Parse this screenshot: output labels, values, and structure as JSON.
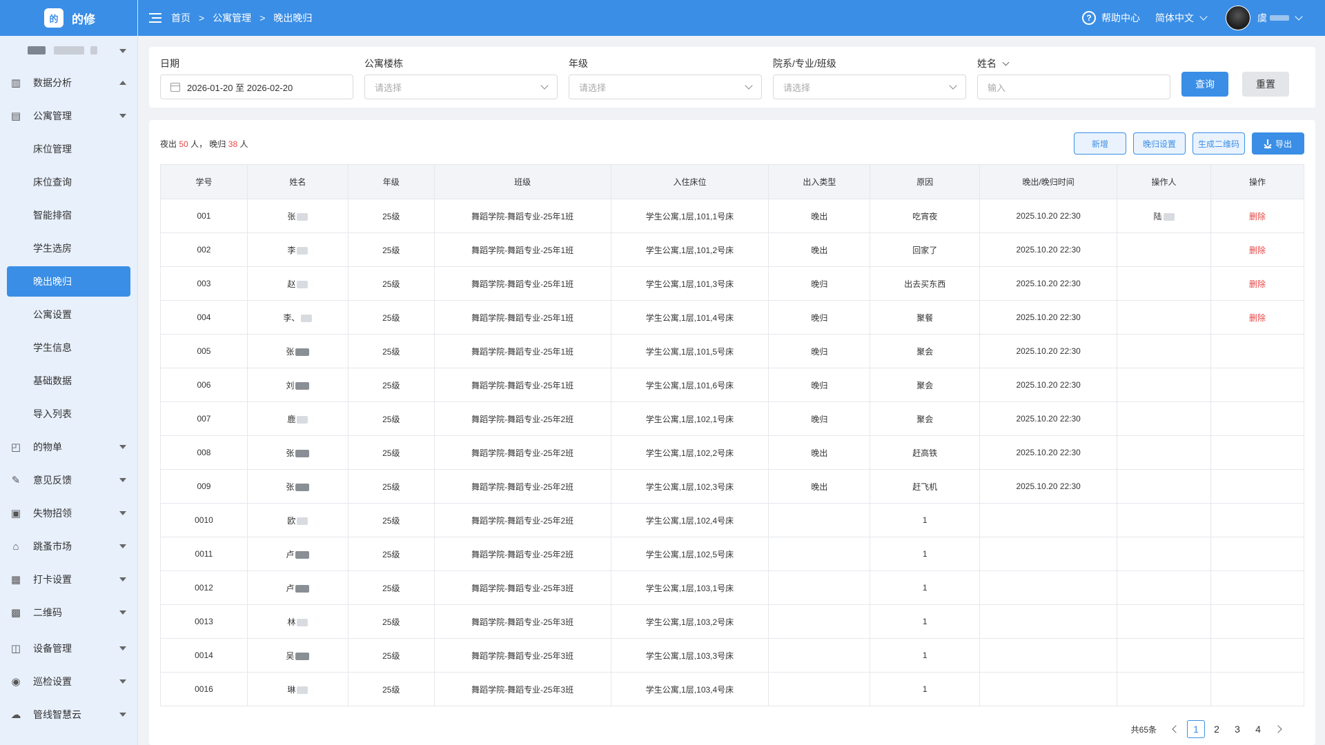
{
  "app": {
    "name": "的修",
    "logo_mark": "的"
  },
  "colors": {
    "primary": "#3a8ee6",
    "danger": "#e84545",
    "sidebar_bg": "#e8f0fb"
  },
  "sidebar": {
    "items": [
      {
        "label": "数据分析",
        "icon": "chart-icon",
        "expanded": true
      },
      {
        "label": "公寓管理",
        "icon": "building-icon",
        "expanded": true,
        "children": [
          "床位管理",
          "床位查询",
          "智能排宿",
          "学生选房",
          "晚出晚归",
          "公寓设置",
          "学生信息",
          "基础数据",
          "导入列表"
        ],
        "active_child": "晚出晚归"
      },
      {
        "label": "的物单",
        "icon": "bag-icon"
      },
      {
        "label": "意见反馈",
        "icon": "edit-icon"
      },
      {
        "label": "失物招领",
        "icon": "box-icon"
      },
      {
        "label": "跳蚤市场",
        "icon": "store-icon"
      },
      {
        "label": "打卡设置",
        "icon": "calendar-icon"
      },
      {
        "label": "二维码",
        "icon": "qrcode-icon"
      },
      {
        "label": "设备管理",
        "icon": "device-icon"
      },
      {
        "label": "巡检设置",
        "icon": "patrol-icon"
      },
      {
        "label": "管线智慧云",
        "icon": "cloud-icon"
      }
    ]
  },
  "topbar": {
    "breadcrumb": [
      "首页",
      "公寓管理",
      "晚出晚归"
    ],
    "help": "帮助中心",
    "language": "简体中文",
    "user_initial": "虞"
  },
  "filters": {
    "date": {
      "label": "日期",
      "value": "2026-01-20 至 2026-02-20"
    },
    "building": {
      "label": "公寓楼栋",
      "placeholder": "请选择"
    },
    "grade": {
      "label": "年级",
      "placeholder": "请选择"
    },
    "dept": {
      "label": "院系/专业/班级",
      "placeholder": "请选择"
    },
    "name": {
      "label": "姓名",
      "placeholder": "输入"
    },
    "query_button": "查询",
    "reset_button": "重置"
  },
  "summary": {
    "out_prefix": "夜出",
    "out_count": "50",
    "out_unit": "人，",
    "late_prefix": "晚归",
    "late_count": "38",
    "late_unit": "人"
  },
  "toolbar": {
    "add": "新增",
    "late_settings": "晚归设置",
    "qrcode": "生成二维码",
    "export": "导出"
  },
  "table": {
    "headers": [
      "学号",
      "姓名",
      "年级",
      "班级",
      "入住床位",
      "出入类型",
      "原因",
      "晚出/晚归时间",
      "操作人",
      "操作"
    ],
    "rows": [
      {
        "id": "001",
        "name": "张",
        "grade": "25级",
        "class": "舞蹈学院-舞蹈专业-25年1班",
        "bed": "学生公寓,1层,101,1号床",
        "type": "晚出",
        "reason": "吃宵夜",
        "time": "2025.10.20 22:30",
        "operator": "陆",
        "action": "删除"
      },
      {
        "id": "002",
        "name": "李",
        "grade": "25级",
        "class": "舞蹈学院-舞蹈专业-25年1班",
        "bed": "学生公寓,1层,101,2号床",
        "type": "晚出",
        "reason": "回家了",
        "time": "2025.10.20 22:30",
        "operator": "",
        "action": "删除"
      },
      {
        "id": "003",
        "name": "赵",
        "grade": "25级",
        "class": "舞蹈学院-舞蹈专业-25年1班",
        "bed": "学生公寓,1层,101,3号床",
        "type": "晚归",
        "reason": "出去买东西",
        "time": "2025.10.20 22:30",
        "operator": "",
        "action": "删除"
      },
      {
        "id": "004",
        "name": "李、",
        "grade": "25级",
        "class": "舞蹈学院-舞蹈专业-25年1班",
        "bed": "学生公寓,1层,101,4号床",
        "type": "晚归",
        "reason": "聚餐",
        "time": "2025.10.20 22:30",
        "operator": "",
        "action": "删除"
      },
      {
        "id": "005",
        "name": "张",
        "grade": "25级",
        "class": "舞蹈学院-舞蹈专业-25年1班",
        "bed": "学生公寓,1层,101,5号床",
        "type": "晚归",
        "reason": "聚会",
        "time": "2025.10.20 22:30",
        "operator": "",
        "action": ""
      },
      {
        "id": "006",
        "name": "刘",
        "grade": "25级",
        "class": "舞蹈学院-舞蹈专业-25年1班",
        "bed": "学生公寓,1层,101,6号床",
        "type": "晚归",
        "reason": "聚会",
        "time": "2025.10.20 22:30",
        "operator": "",
        "action": ""
      },
      {
        "id": "007",
        "name": "鹿",
        "grade": "25级",
        "class": "舞蹈学院-舞蹈专业-25年2班",
        "bed": "学生公寓,1层,102,1号床",
        "type": "晚归",
        "reason": "聚会",
        "time": "2025.10.20 22:30",
        "operator": "",
        "action": ""
      },
      {
        "id": "008",
        "name": "张",
        "grade": "25级",
        "class": "舞蹈学院-舞蹈专业-25年2班",
        "bed": "学生公寓,1层,102,2号床",
        "type": "晚出",
        "reason": "赶高铁",
        "time": "2025.10.20 22:30",
        "operator": "",
        "action": ""
      },
      {
        "id": "009",
        "name": "张",
        "grade": "25级",
        "class": "舞蹈学院-舞蹈专业-25年2班",
        "bed": "学生公寓,1层,102,3号床",
        "type": "晚出",
        "reason": "赶飞机",
        "time": "2025.10.20 22:30",
        "operator": "",
        "action": ""
      },
      {
        "id": "0010",
        "name": "欧",
        "grade": "25级",
        "class": "舞蹈学院-舞蹈专业-25年2班",
        "bed": "学生公寓,1层,102,4号床",
        "type": "",
        "reason": "1",
        "time": "",
        "operator": "",
        "action": ""
      },
      {
        "id": "0011",
        "name": "卢",
        "grade": "25级",
        "class": "舞蹈学院-舞蹈专业-25年2班",
        "bed": "学生公寓,1层,102,5号床",
        "type": "",
        "reason": "1",
        "time": "",
        "operator": "",
        "action": ""
      },
      {
        "id": "0012",
        "name": "卢",
        "grade": "25级",
        "class": "舞蹈学院-舞蹈专业-25年3班",
        "bed": "学生公寓,1层,103,1号床",
        "type": "",
        "reason": "1",
        "time": "",
        "operator": "",
        "action": ""
      },
      {
        "id": "0013",
        "name": "林",
        "grade": "25级",
        "class": "舞蹈学院-舞蹈专业-25年3班",
        "bed": "学生公寓,1层,103,2号床",
        "type": "",
        "reason": "1",
        "time": "",
        "operator": "",
        "action": ""
      },
      {
        "id": "0014",
        "name": "吴",
        "grade": "25级",
        "class": "舞蹈学院-舞蹈专业-25年3班",
        "bed": "学生公寓,1层,103,3号床",
        "type": "",
        "reason": "1",
        "time": "",
        "operator": "",
        "action": ""
      },
      {
        "id": "0016",
        "name": "琳",
        "grade": "25级",
        "class": "舞蹈学院-舞蹈专业-25年3班",
        "bed": "学生公寓,1层,103,4号床",
        "type": "",
        "reason": "1",
        "time": "",
        "operator": "",
        "action": ""
      }
    ]
  },
  "pagination": {
    "total": "共65条",
    "pages": [
      "1",
      "2",
      "3",
      "4"
    ],
    "current": "1"
  }
}
